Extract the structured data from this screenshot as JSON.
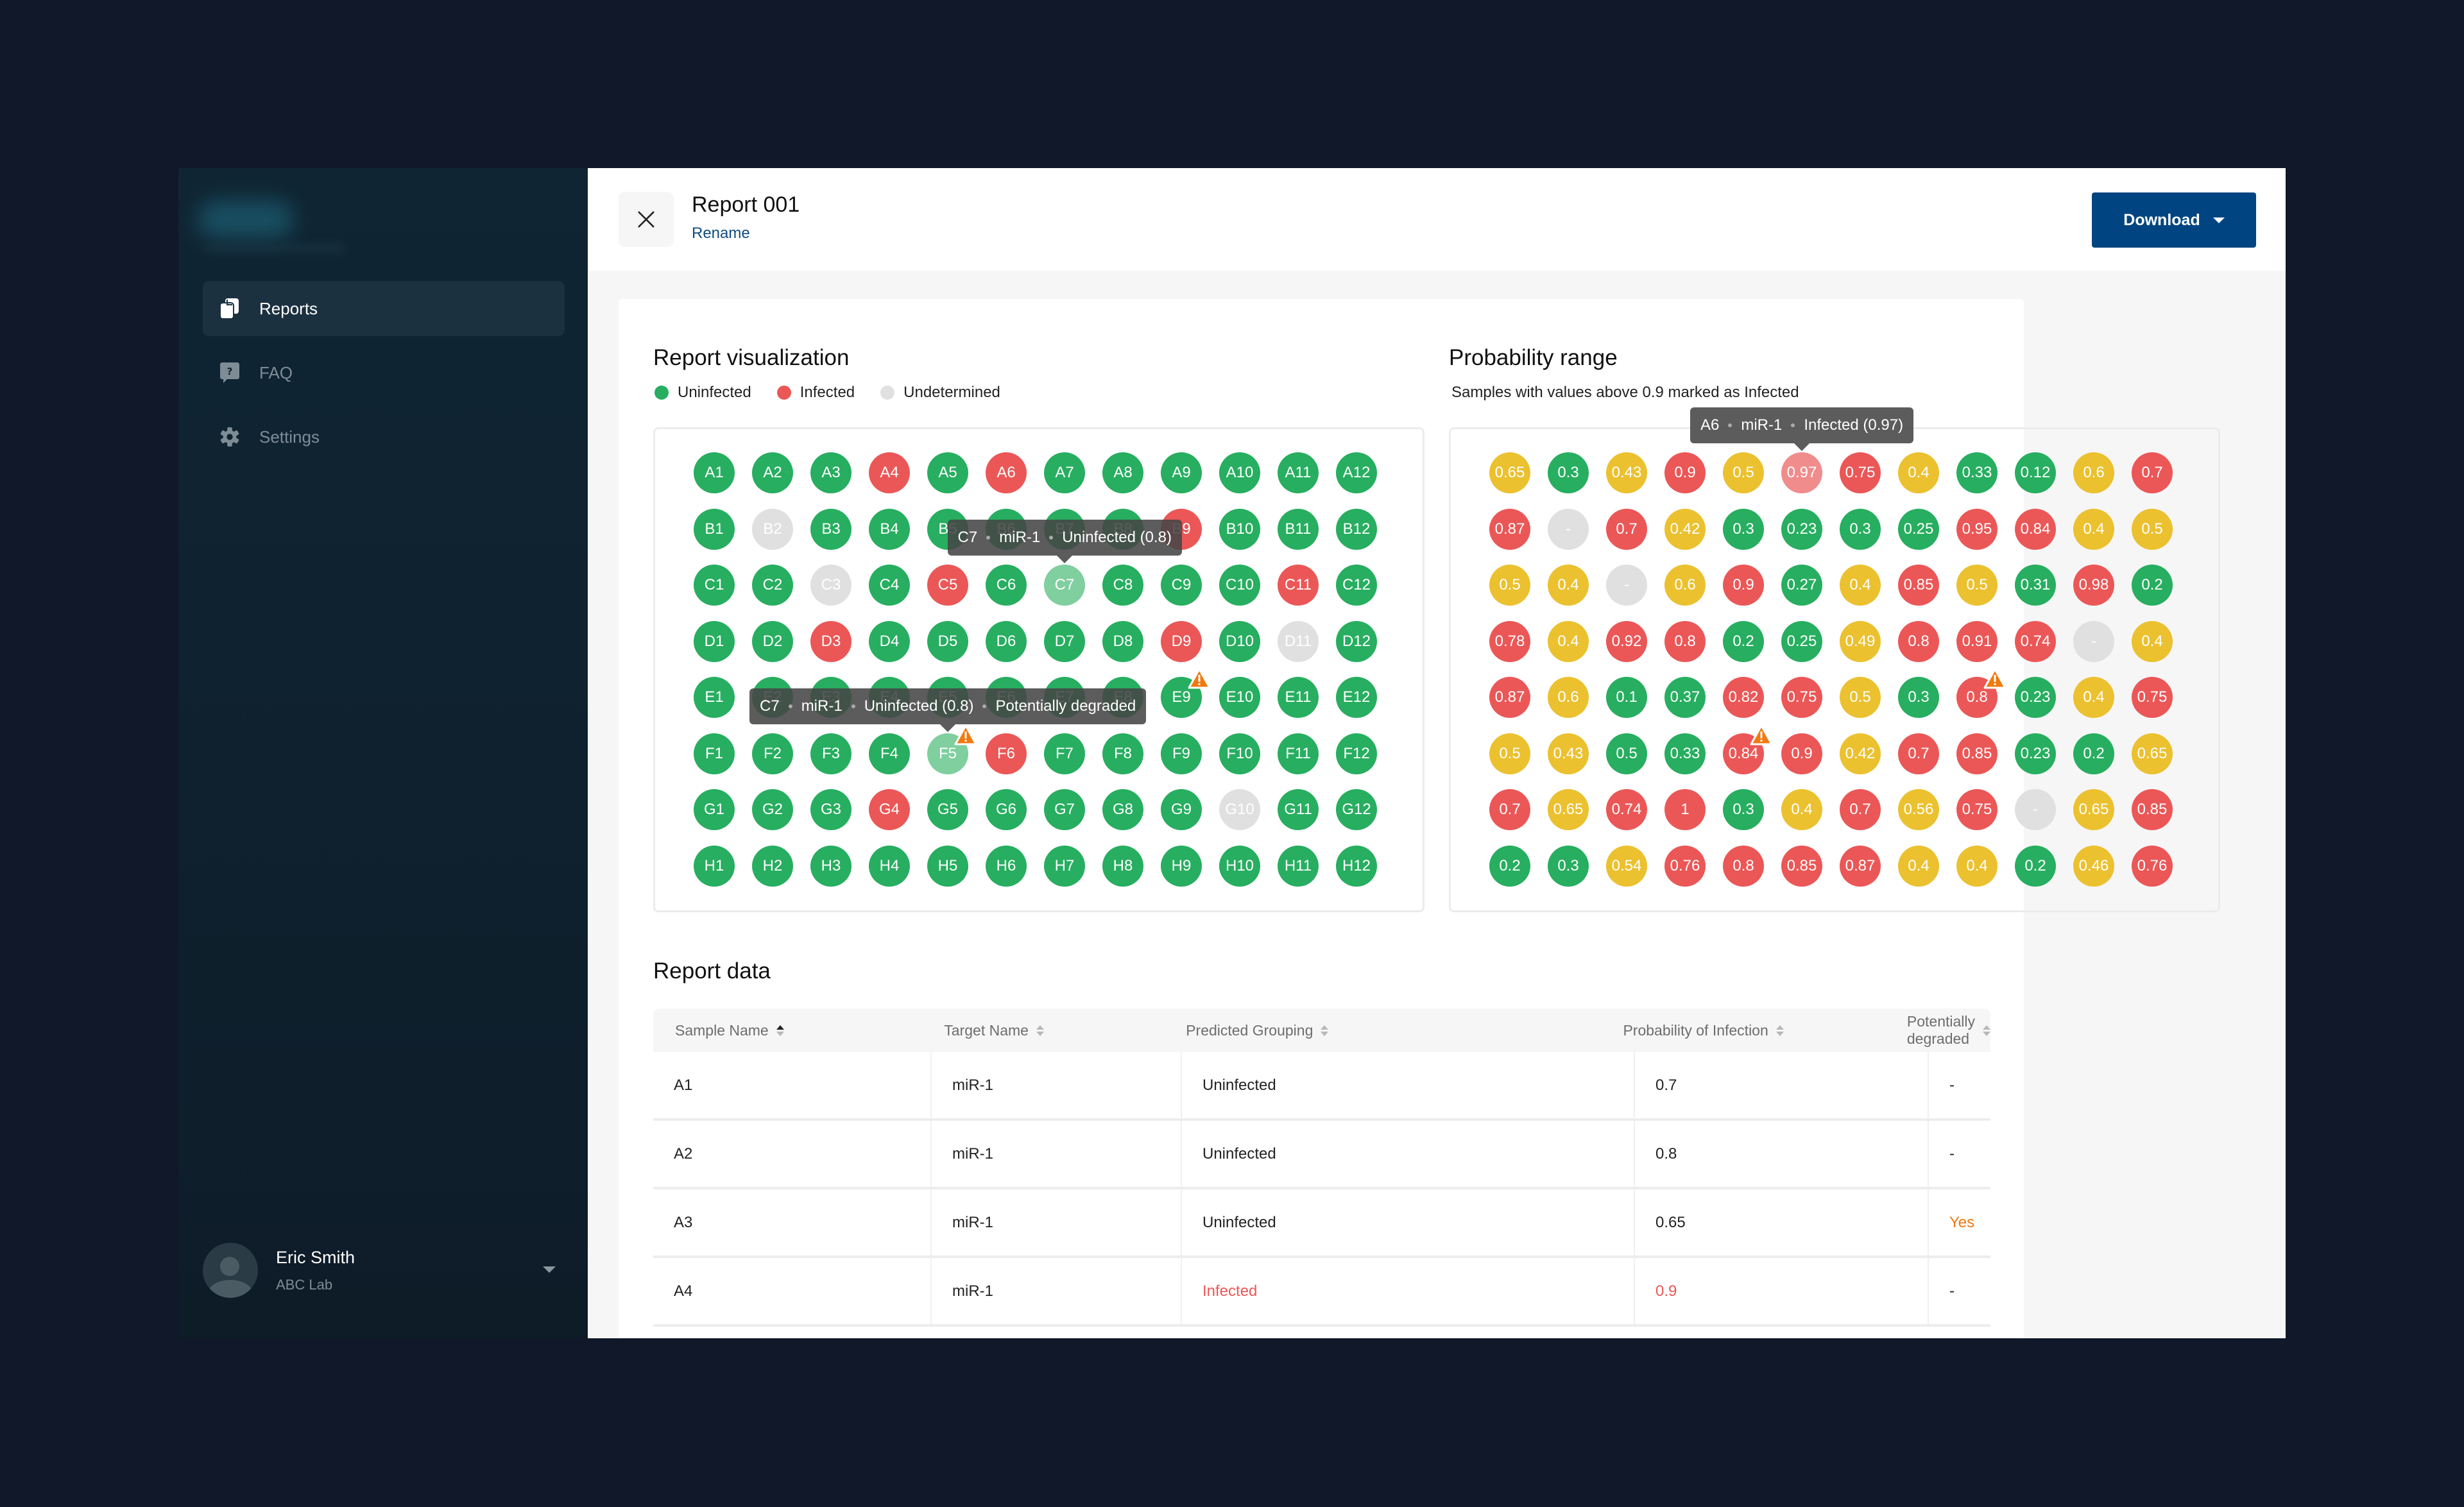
{
  "sidebar": {
    "nav": [
      {
        "label": "Reports",
        "icon": "reports-icon",
        "active": true
      },
      {
        "label": "FAQ",
        "icon": "faq-icon",
        "active": false
      },
      {
        "label": "Settings",
        "icon": "gear-icon",
        "active": false
      }
    ],
    "user": {
      "name": "Eric Smith",
      "org": "ABC Lab"
    }
  },
  "header": {
    "title": "Report 001",
    "rename_label": "Rename",
    "download_label": "Download"
  },
  "colors": {
    "uninfected": "#27ae60",
    "infected": "#eb5757",
    "undetermined": "#e0e0e0",
    "mid": "#ebc12f",
    "warning": "#f2790f",
    "brand": "#004581"
  },
  "visualization": {
    "title": "Report visualization",
    "legend": [
      {
        "label": "Uninfected",
        "status": "uninfected"
      },
      {
        "label": "Infected",
        "status": "infected"
      },
      {
        "label": "Undetermined",
        "status": "undetermined"
      }
    ],
    "rows": [
      "A",
      "B",
      "C",
      "D",
      "E",
      "F",
      "G",
      "H"
    ],
    "status_grid": [
      "UUUIUIUUUUUU",
      "UNUUUUUUIUUU",
      "UUNUIUUUUUIU",
      "UUIUUUUUIUNU",
      "UUUUUUUUUUUU",
      "UUUUUIUUUUUU",
      "UUUIUUUUUNUU",
      "UUUUUUUUUUUU"
    ],
    "highlighted": [
      "C7",
      "F5"
    ],
    "degraded": [
      "E9",
      "F5"
    ],
    "tooltips": [
      {
        "anchor": "C7",
        "parts": [
          "C7",
          "miR-1",
          "Uninfected (0.8)"
        ]
      },
      {
        "anchor": "F5",
        "parts": [
          "C7",
          "miR-1",
          "Uninfected (0.8)",
          "Potentially degraded"
        ]
      }
    ]
  },
  "probability": {
    "title": "Probability range",
    "subtitle": "Samples with values above 0.9 marked as Infected",
    "values": [
      [
        "0.65",
        "0.3",
        "0.43",
        "0.9",
        "0.5",
        "0.97",
        "0.75",
        "0.4",
        "0.33",
        "0.12",
        "0.6",
        "0.7"
      ],
      [
        "0.87",
        "-",
        "0.7",
        "0.42",
        "0.3",
        "0.23",
        "0.3",
        "0.25",
        "0.95",
        "0.84",
        "0.4",
        "0.5"
      ],
      [
        "0.5",
        "0.4",
        "-",
        "0.6",
        "0.9",
        "0.27",
        "0.4",
        "0.85",
        "0.5",
        "0.31",
        "0.98",
        "0.2"
      ],
      [
        "0.78",
        "0.4",
        "0.92",
        "0.8",
        "0.2",
        "0.25",
        "0.49",
        "0.8",
        "0.91",
        "0.74",
        "-",
        "0.4"
      ],
      [
        "0.87",
        "0.6",
        "0.1",
        "0.37",
        "0.82",
        "0.75",
        "0.5",
        "0.3",
        "0.8",
        "0.23",
        "0.4",
        "0.75"
      ],
      [
        "0.5",
        "0.43",
        "0.5",
        "0.33",
        "0.84",
        "0.9",
        "0.42",
        "0.7",
        "0.85",
        "0.23",
        "0.2",
        "0.65"
      ],
      [
        "0.7",
        "0.65",
        "0.74",
        "1",
        "0.3",
        "0.4",
        "0.7",
        "0.56",
        "0.75",
        "-",
        "0.65",
        "0.85"
      ],
      [
        "0.2",
        "0.3",
        "0.54",
        "0.76",
        "0.8",
        "0.85",
        "0.87",
        "0.4",
        "0.4",
        "0.2",
        "0.46",
        "0.76"
      ]
    ],
    "color_grid": [
      "YGYRYRRYGGYR",
      "RNRYGGGGRRYY",
      "YYNYRGYRYGRG",
      "RYRRGGYRRRNY",
      "RYGGRRYGRGYR",
      "YYGGRRYRRGGY",
      "RYRRGYRYRNYR",
      "GGYRRRRYYGYR"
    ],
    "highlighted": [
      "A6"
    ],
    "degraded": [
      "E9",
      "F5"
    ],
    "tooltip": {
      "anchor": "A6",
      "parts": [
        "A6",
        "miR-1",
        "Infected (0.97)"
      ]
    }
  },
  "report_data": {
    "title": "Report data",
    "columns": [
      {
        "label": "Sample Name",
        "sorted": true
      },
      {
        "label": "Target Name",
        "sorted": false
      },
      {
        "label": "Predicted Grouping",
        "sorted": false
      },
      {
        "label": "Probability of Infection",
        "sorted": false
      },
      {
        "label": "Potentially degraded",
        "sorted": false
      }
    ],
    "rows": [
      {
        "sample": "A1",
        "target": "miR-1",
        "grouping": "Uninfected",
        "probability": "0.7",
        "degraded": "-"
      },
      {
        "sample": "A2",
        "target": "miR-1",
        "grouping": "Uninfected",
        "probability": "0.8",
        "degraded": "-"
      },
      {
        "sample": "A3",
        "target": "miR-1",
        "grouping": "Uninfected",
        "probability": "0.65",
        "degraded": "Yes"
      },
      {
        "sample": "A4",
        "target": "miR-1",
        "grouping": "Infected",
        "probability": "0.9",
        "degraded": "-"
      }
    ]
  }
}
